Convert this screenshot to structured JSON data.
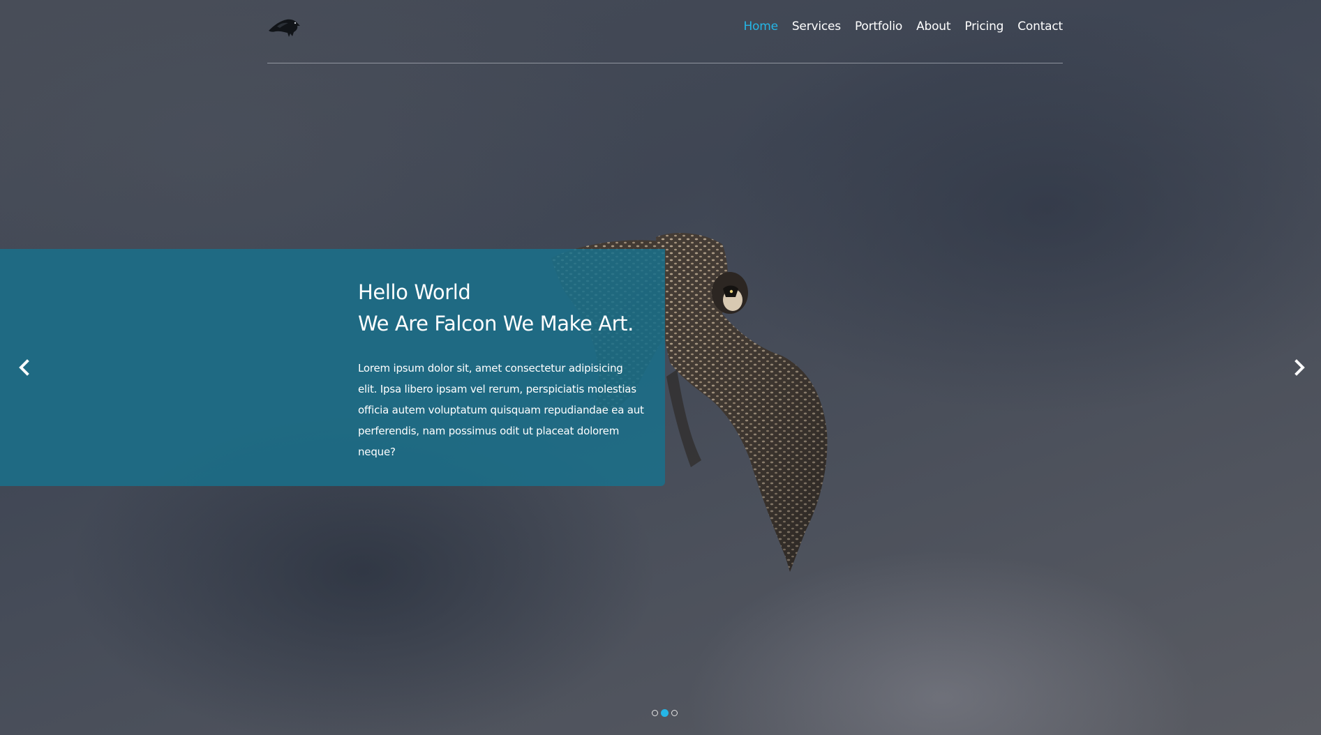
{
  "nav": {
    "logo_icon": "falcon-logo-icon",
    "items": [
      {
        "label": "Home",
        "active": true
      },
      {
        "label": "Services",
        "active": false
      },
      {
        "label": "Portfolio",
        "active": false
      },
      {
        "label": "About",
        "active": false
      },
      {
        "label": "Pricing",
        "active": false
      },
      {
        "label": "Contact",
        "active": false
      }
    ],
    "active_color": "#25b6e6"
  },
  "slider": {
    "caption": {
      "title_line1": "Hello World",
      "title_line2": "We Are Falcon We Make Art.",
      "body": "Lorem ipsum dolor sit, amet consectetur adipisicing elit. Ipsa libero ipsam vel rerum, perspiciatis molestias officia autem voluptatum quisquam repudiandae ea aut perferendis, nam possimus odit ut placeat dolorem neque?"
    },
    "prev_icon": "chevron-left-icon",
    "next_icon": "chevron-right-icon",
    "dots": [
      false,
      true,
      false
    ],
    "caption_color": "#1a708a"
  }
}
